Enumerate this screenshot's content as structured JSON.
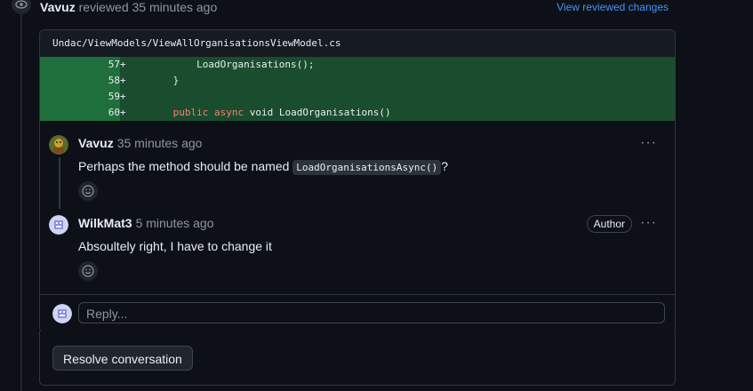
{
  "review_header": {
    "user": "Vavuz",
    "action": "reviewed 35 minutes ago",
    "view_changes_link": "View reviewed changes"
  },
  "file": {
    "path": "Undac/ViewModels/ViewAllOrganisationsViewModel.cs",
    "lines": [
      {
        "num": "57",
        "code": "+            LoadOrganisations();"
      },
      {
        "num": "58",
        "code": "+        }"
      },
      {
        "num": "59",
        "code": "+"
      },
      {
        "num": "60",
        "code_parts": [
          "+        ",
          "public",
          " ",
          "async",
          " void LoadOrganisations()"
        ]
      }
    ]
  },
  "comments": [
    {
      "author": "Vavuz",
      "time": "35 minutes ago",
      "body_prefix": "Perhaps the method should be named ",
      "body_code": "LoadOrganisationsAsync()",
      "body_suffix": "?",
      "more_label": "···"
    },
    {
      "author": "WilkMat3",
      "time": "5 minutes ago",
      "badge": "Author",
      "body": "Absoultely right, I have to change it",
      "more_label": "···"
    }
  ],
  "reply": {
    "placeholder": "Reply..."
  },
  "resolve_button": "Resolve conversation",
  "icons": {
    "review": "eye-icon",
    "reaction": "smiley-icon",
    "more": "kebab-horizontal-icon"
  }
}
